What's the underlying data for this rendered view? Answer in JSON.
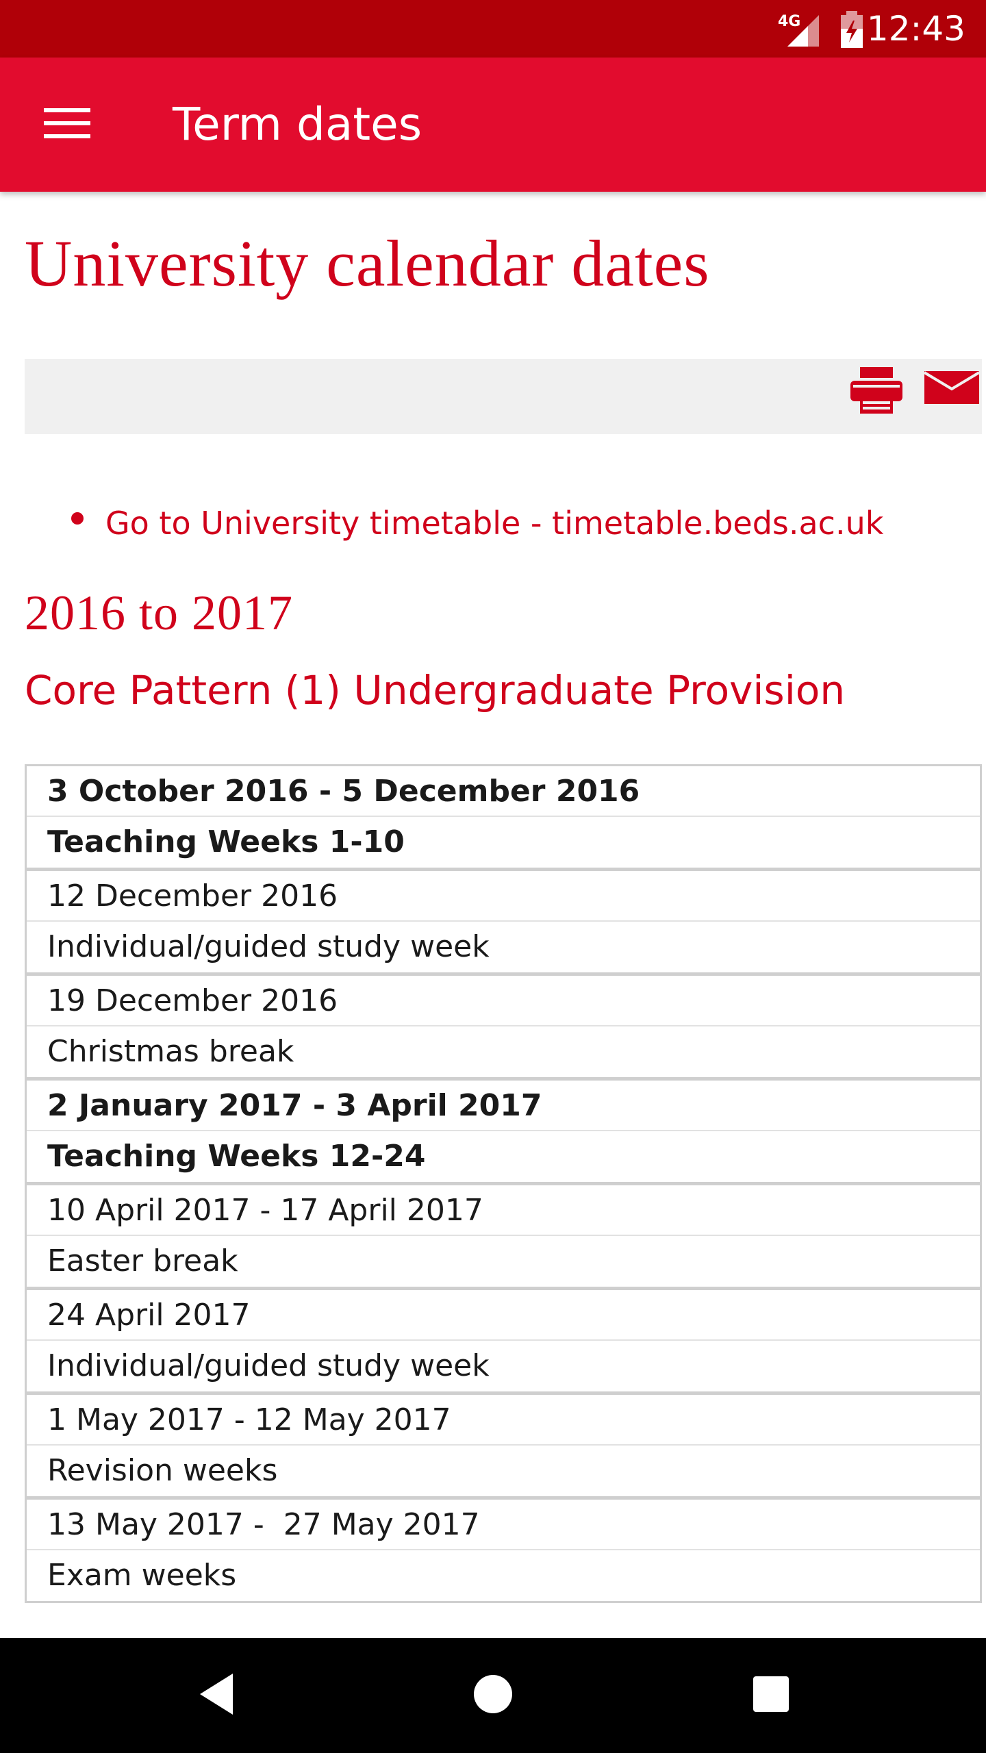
{
  "status_bar": {
    "network": "4G",
    "time": "12:43"
  },
  "app_bar": {
    "title": "Term dates",
    "menu_icon": "hamburger-menu-icon"
  },
  "page": {
    "title": "University calendar dates",
    "toolbar": {
      "print_icon": "printer-icon",
      "mail_icon": "envelope-icon"
    },
    "links": [
      {
        "label": "Go to University timetable - timetable.beds.ac.uk"
      }
    ],
    "year_heading": "2016 to 2017",
    "sub_heading": "Core Pattern (1) Undergraduate Provision",
    "table": {
      "rows": [
        {
          "date": "3 October 2016 - 5 December 2016",
          "description": "Teaching Weeks 1-10",
          "bold": true
        },
        {
          "date": "12 December 2016",
          "description": "Individual/guided study week",
          "bold": false
        },
        {
          "date": "19 December 2016",
          "description": "Christmas break",
          "bold": false
        },
        {
          "date": "2 January 2017 - 3 April 2017",
          "description": "Teaching Weeks 12-24",
          "bold": true
        },
        {
          "date": "10 April 2017 - 17 April 2017",
          "description": "Easter break",
          "bold": false
        },
        {
          "date": "24 April 2017",
          "description": "Individual/guided study week",
          "bold": false
        },
        {
          "date": "1 May 2017 - 12 May 2017",
          "description": "Revision weeks",
          "bold": false
        },
        {
          "date": "13 May 2017 -  27 May 2017",
          "description": "Exam weeks",
          "bold": false
        }
      ]
    }
  },
  "nav_bar": {
    "back_icon": "back-triangle-icon",
    "home_icon": "home-circle-icon",
    "recents_icon": "recents-square-icon"
  },
  "colors": {
    "status_bar": "#b00008",
    "app_bar": "#e20c2e",
    "accent_text": "#d0021b",
    "toolbar_bg": "#f0f0f0",
    "nav_bar": "#000000"
  }
}
